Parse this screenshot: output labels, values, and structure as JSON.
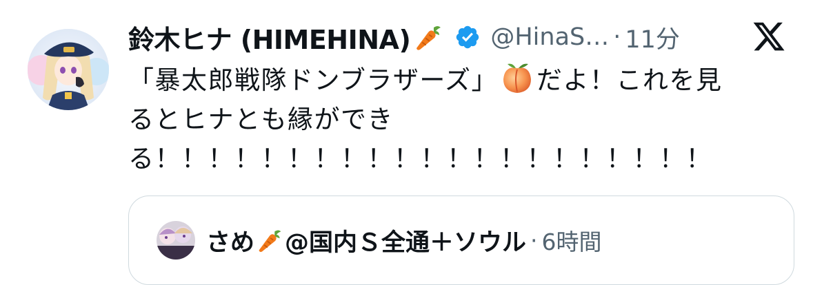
{
  "tweet": {
    "author_name": "鈴木ヒナ (HIMEHINA)",
    "handle": "@HinaS…",
    "separator": "·",
    "time": "11分",
    "text_lines": [
      {
        "before": "「暴太郎戦隊ドンブラザーズ」",
        "emoji": "peach-emoji",
        "after": "だよ！これを見"
      },
      {
        "text": "るとヒナとも縁ができ"
      },
      {
        "text": "る！！！！！！！！！！！！！！！！！！！！！"
      }
    ],
    "icons": {
      "name_emoji": "carrot-emoji",
      "verified": "verified-badge-icon",
      "platform": "x-logo-icon"
    }
  },
  "quote": {
    "author_name": "さめ",
    "name_emoji": "carrot-emoji",
    "handle": "@国内Ｓ全通＋ソウル",
    "separator": "·",
    "time": "6時間"
  },
  "colors": {
    "text_primary": "#0f1419",
    "text_secondary": "#536471",
    "verified_blue": "#1d9bf0",
    "card_border": "#cfd9de"
  }
}
